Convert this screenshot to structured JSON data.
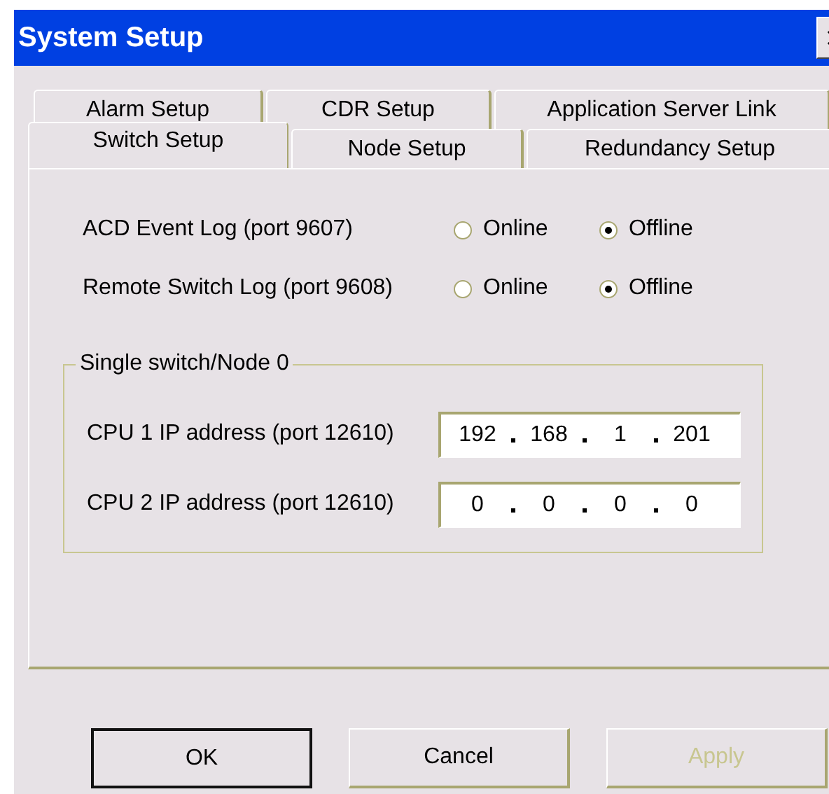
{
  "window": {
    "title": "System Setup"
  },
  "tab_rows": [
    {
      "tabs": [
        {
          "label": "Alarm Setup",
          "selected": false
        },
        {
          "label": "CDR Setup",
          "selected": false
        },
        {
          "label": "Application Server Link",
          "selected": false
        }
      ]
    },
    {
      "tabs": [
        {
          "label": "Switch Setup",
          "selected": true
        },
        {
          "label": "Node Setup",
          "selected": false
        },
        {
          "label": "Redundancy Setup",
          "selected": false
        }
      ]
    }
  ],
  "logs": [
    {
      "name": "ACD Event Log (port 9607)",
      "options": [
        {
          "label": "Online",
          "selected": false
        },
        {
          "label": "Offline",
          "selected": true
        }
      ]
    },
    {
      "name": "Remote Switch Log (port 9608)",
      "options": [
        {
          "label": "Online",
          "selected": false
        },
        {
          "label": "Offline",
          "selected": true
        }
      ]
    }
  ],
  "group": {
    "title": "Single switch/Node 0",
    "fields": [
      {
        "label": "CPU 1 IP address (port 12610)",
        "octets": [
          "192",
          "168",
          "1",
          "201"
        ]
      },
      {
        "label": "CPU 2 IP address (port 12610)",
        "octets": [
          "0",
          "0",
          "0",
          "0"
        ]
      }
    ]
  },
  "buttons": [
    {
      "label": "OK",
      "default": true,
      "disabled": false
    },
    {
      "label": "Cancel",
      "default": false,
      "disabled": false
    },
    {
      "label": "Apply",
      "default": false,
      "disabled": true
    }
  ]
}
